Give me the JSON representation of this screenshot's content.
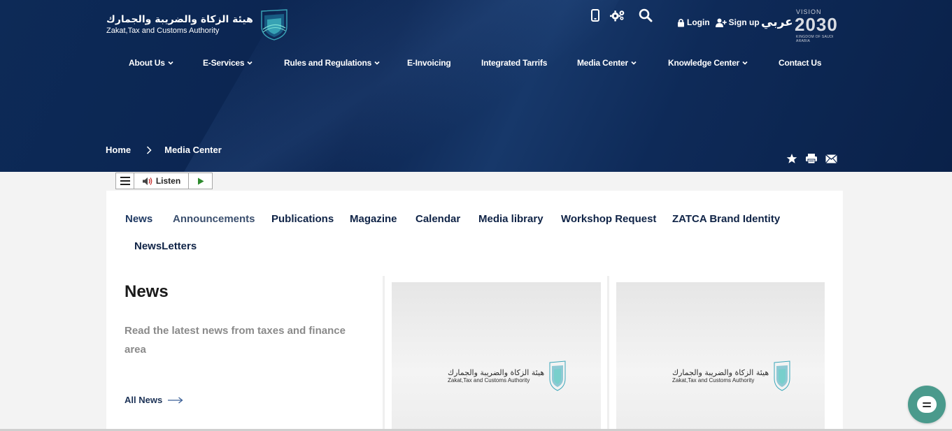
{
  "brand": {
    "name_ar": "هيئة الزكاة والضريبة والجمارك",
    "name_en": "Zakat,Tax and Customs Authority"
  },
  "header": {
    "icons": [
      "mobile-icon",
      "gears-icon",
      "search-icon"
    ],
    "login_label": "Login",
    "signup_label": "Sign up",
    "language_label": "عربي",
    "vision": {
      "label": "VISION",
      "year": "2030",
      "caption": "KINGDOM OF SAUDI ARABIA"
    }
  },
  "nav": {
    "items": [
      {
        "label": "About Us",
        "dropdown": true
      },
      {
        "label": "E-Services",
        "dropdown": true
      },
      {
        "label": "Rules and Regulations",
        "dropdown": true
      },
      {
        "label": "E-Invoicing",
        "dropdown": false
      },
      {
        "label": "Integrated Tarrifs",
        "dropdown": false
      },
      {
        "label": "Media Center",
        "dropdown": true
      },
      {
        "label": "Knowledge Center",
        "dropdown": true
      },
      {
        "label": "Contact Us",
        "dropdown": false
      }
    ]
  },
  "breadcrumb": {
    "home": "Home",
    "current": "Media Center"
  },
  "share": [
    "star-icon",
    "print-icon",
    "mail-icon"
  ],
  "listen": {
    "label": "Listen"
  },
  "tabs": [
    "News",
    "Announcements",
    "Publications",
    "Magazine",
    "Calendar",
    "Media library",
    "Workshop Request",
    "ZATCA Brand Identity",
    "NewsLetters"
  ],
  "news": {
    "title": "News",
    "description": "Read the latest news from taxes and finance area",
    "all_news_label": "All News"
  },
  "cards": [
    {
      "logo_ar": "هيئة الزكاة والضريبة والجمارك",
      "logo_en": "Zakat,Tax and Customs Authority"
    },
    {
      "logo_ar": "هيئة الزكاة والضريبة والجمارك",
      "logo_en": "Zakat,Tax and Customs Authority"
    }
  ],
  "colors": {
    "header_bg": "#0b2450",
    "nav_text": "#ffffff",
    "tab_text": "#0f2346",
    "chat_button": "#4a9a8c",
    "listen_play": "#2e8b2e"
  }
}
